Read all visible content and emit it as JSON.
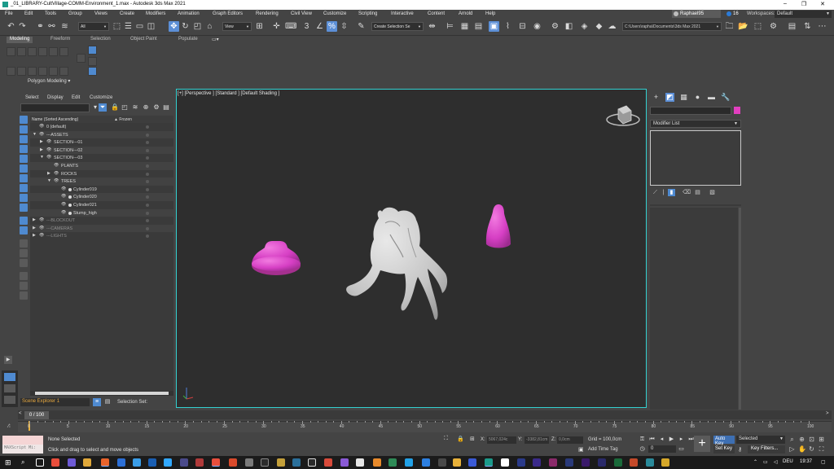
{
  "window": {
    "title": "_01_LIBRARY-CultVillage-COMM-Environment_1.max - Autodesk 3ds Max 2021",
    "controls": [
      "–",
      "❐",
      "✕"
    ]
  },
  "menu": {
    "items": [
      "File",
      "Edit",
      "Tools",
      "Group",
      "Views",
      "Create",
      "Modifiers",
      "Animation",
      "Graph Editors",
      "Rendering",
      "Civil View",
      "Customize",
      "Scripting",
      "Interactive",
      "Content",
      "Arnold",
      "Help"
    ],
    "user": "Raphael95",
    "notifications": "16",
    "workspaces_label": "Workspaces:",
    "workspace": "Default"
  },
  "toolbar": {
    "filter": "All",
    "ref_coord": "View",
    "selection_set": "Create Selection Se",
    "project_path": "C:\\Users\\rapha\\Documents\\3ds Max 2021"
  },
  "ribbon": {
    "tabs": [
      "Modeling",
      "Freeform",
      "Selection",
      "Object Paint",
      "Populate"
    ],
    "panel_label": "Polygon Modeling ▾"
  },
  "scene_explorer": {
    "menu": [
      "Select",
      "Display",
      "Edit",
      "Customize"
    ],
    "col_name": "Name (Sorted Ascending)",
    "col_frozen": "▲ Frozen",
    "rows": [
      {
        "label": "0 (default)",
        "indent": 0,
        "exp": "",
        "dim": false,
        "dot": false
      },
      {
        "label": "---ASSETS",
        "indent": 0,
        "exp": "▼",
        "dim": false,
        "dot": false
      },
      {
        "label": "SECTION---01",
        "indent": 1,
        "exp": "▶",
        "dim": false,
        "dot": false
      },
      {
        "label": "SECTION---02",
        "indent": 1,
        "exp": "▶",
        "dim": false,
        "dot": false
      },
      {
        "label": "SECTION---03",
        "indent": 1,
        "exp": "▼",
        "dim": false,
        "dot": false
      },
      {
        "label": "PLANTS",
        "indent": 2,
        "exp": "",
        "dim": false,
        "dot": false
      },
      {
        "label": "ROCKS",
        "indent": 2,
        "exp": "▶",
        "dim": false,
        "dot": false
      },
      {
        "label": "TREES",
        "indent": 2,
        "exp": "▼",
        "dim": false,
        "dot": false
      },
      {
        "label": "Cylinder019",
        "indent": 3,
        "exp": "",
        "dim": false,
        "dot": true
      },
      {
        "label": "Cylinder020",
        "indent": 3,
        "exp": "",
        "dim": false,
        "dot": true
      },
      {
        "label": "Cylinder021",
        "indent": 3,
        "exp": "",
        "dim": false,
        "dot": true
      },
      {
        "label": "Stump_high",
        "indent": 3,
        "exp": "",
        "dim": false,
        "dot": true
      },
      {
        "label": "---BLOCKOUT",
        "indent": 0,
        "exp": "▶",
        "dim": true,
        "dot": false
      },
      {
        "label": "---CAMERAS",
        "indent": 0,
        "exp": "▶",
        "dim": true,
        "dot": false
      },
      {
        "label": "---LIGHTS",
        "indent": 0,
        "exp": "▶",
        "dim": true,
        "dot": false
      }
    ],
    "explorer_name": "Scene Explorer 1",
    "selection_set_label": "Selection Set:"
  },
  "viewport": {
    "label": "[+] [Perspective ] [Standard ] [Default Shading ]",
    "object_color": "#d63fc4",
    "stump_color": "#c9c9c9",
    "border_color": "#33d1d1"
  },
  "command_panel": {
    "modifier_list": "Modifier List",
    "object_color": "#e23fc0"
  },
  "timeline": {
    "frame_display": "0 / 100",
    "ticks": [
      "0",
      "5",
      "10",
      "15",
      "20",
      "25",
      "30",
      "35",
      "40",
      "45",
      "50",
      "55",
      "60",
      "65",
      "70",
      "75",
      "80",
      "85",
      "90",
      "95",
      "100"
    ]
  },
  "status": {
    "maxscript": "MAXScript Mi:",
    "selected": "None Selected",
    "prompt": "Click and drag to select and move objects",
    "x_label": "X:",
    "x_value": "5067,024c",
    "y_label": "Y:",
    "y_value": "-3382,81cm",
    "z_label": "Z:",
    "z_value": "0,0cm",
    "grid": "Grid = 100,0cm",
    "add_time_tag": "Add Time Tag",
    "frame": "0",
    "auto_key": "Auto Key",
    "set_key": "Set Key",
    "selected_dd": "Selected",
    "key_filters": "Key Filters..."
  },
  "taskbar": {
    "language": "DEU",
    "time": "19:37"
  }
}
